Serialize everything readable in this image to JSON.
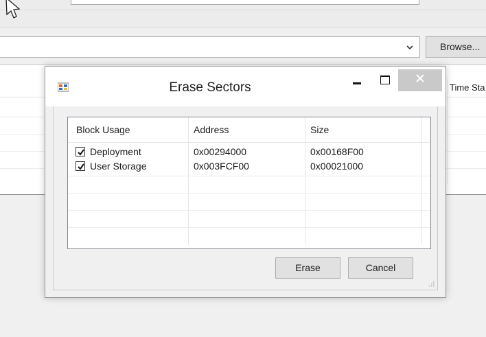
{
  "background_app": {
    "path_combo_value": "",
    "browse_label": "Browse...",
    "list_columns": [
      "Time Sta"
    ]
  },
  "dialog": {
    "title": "Erase Sectors",
    "columns": [
      "Block Usage",
      "Address",
      "Size"
    ],
    "rows": [
      {
        "checked": true,
        "block_usage": "Deployment",
        "address": "0x00294000",
        "size": "0x00168F00"
      },
      {
        "checked": true,
        "block_usage": "User Storage",
        "address": "0x003FCF00",
        "size": "0x00021000"
      }
    ],
    "erase_label": "Erase",
    "cancel_label": "Cancel"
  },
  "colors": {
    "window_bg": "#f0f0f0",
    "close_button_bg": "#c9c9c9",
    "list_border": "#828790"
  },
  "icons": [
    "mouse-cursor-icon",
    "app-icon",
    "minimize-icon",
    "maximize-icon",
    "close-icon",
    "checkmark-icon",
    "chevron-down-icon",
    "resize-grip-icon"
  ]
}
